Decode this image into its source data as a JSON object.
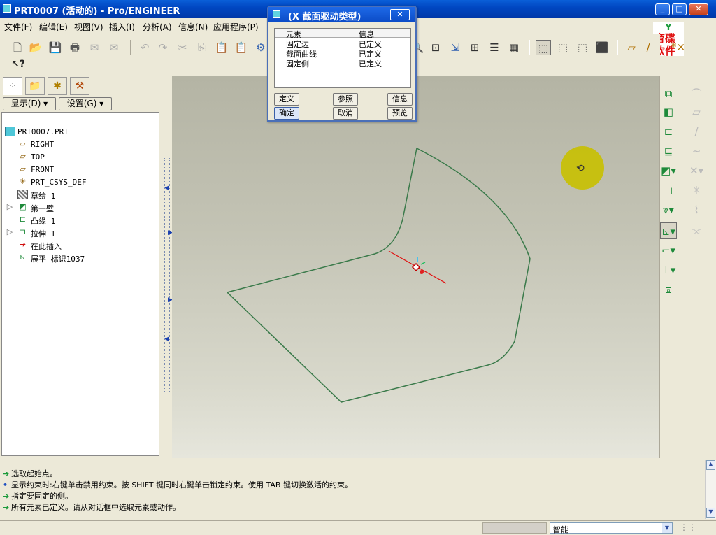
{
  "window": {
    "title": "PRT0007 (活动的) - Pro/ENGINEER",
    "min": "_",
    "max": "□",
    "close": "✕"
  },
  "menu": [
    "文件(F)",
    "编辑(E)",
    "视图(V)",
    "插入(I)",
    "分析(A)",
    "信息(N)",
    "应用程序(P)"
  ],
  "logo": {
    "line1": "育碟",
    "line2": "软件"
  },
  "left_tabs": [
    "model-tree-icon",
    "folder-browser-icon",
    "favorites-icon",
    "tools-icon"
  ],
  "left_buttons": {
    "show": "显示(D) ▾",
    "settings": "设置(G) ▾"
  },
  "tree": [
    {
      "label": "PRT0007.PRT",
      "icon": "part-icon"
    },
    {
      "label": "RIGHT",
      "icon": "datum-plane-icon"
    },
    {
      "label": "TOP",
      "icon": "datum-plane-icon"
    },
    {
      "label": "FRONT",
      "icon": "datum-plane-icon"
    },
    {
      "label": "PRT_CSYS_DEF",
      "icon": "csys-icon"
    },
    {
      "label": "草绘 1",
      "icon": "sketch-icon"
    },
    {
      "label": "第一壁",
      "icon": "first-wall-icon"
    },
    {
      "label": "凸缘 1",
      "icon": "flange-icon"
    },
    {
      "label": "拉伸 1",
      "icon": "extrude-icon"
    },
    {
      "label": "在此插入",
      "icon": "insert-here-icon"
    },
    {
      "label": "展平 标识1037",
      "icon": "unbend-icon"
    }
  ],
  "dialog": {
    "title": "(X 截面驱动类型)",
    "col_element": "元素",
    "col_info": "信息",
    "rows": [
      {
        "element": "固定边",
        "info": "已定义"
      },
      {
        "element": "截面曲线",
        "info": "已定义"
      },
      {
        "element": "固定侧",
        "info": "已定义"
      }
    ],
    "define": "定义",
    "refs": "参照",
    "info": "信息",
    "ok": "确定",
    "cancel": "取消",
    "preview": "预览"
  },
  "messages": [
    {
      "icon": "arrow",
      "text": "选取起始点。"
    },
    {
      "icon": "dot",
      "text": "显示约束时:右键单击禁用约束。按 SHIFT 键同时右键单击锁定约束。使用 TAB 键切换激活的约束。"
    },
    {
      "icon": "arrow",
      "text": "指定要固定的侧。"
    },
    {
      "icon": "arrow",
      "text": "所有元素已定义。请从对话框中选取元素或动作。"
    }
  ],
  "status": {
    "filter": "智能"
  },
  "colors": {
    "title_bar": "#0a5fd8",
    "sketch_line": "#3a7a4a",
    "cursor_halo": "#c8c000"
  }
}
